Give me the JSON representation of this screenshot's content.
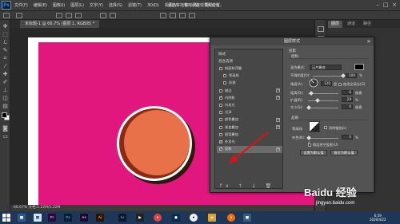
{
  "app": {
    "logo": "Ps"
  },
  "menu": [
    "文件(F)",
    "编辑(E)",
    "图像(I)",
    "图层(L)",
    "文字(Y)",
    "选择(S)",
    "滤镜(T)",
    "3D(D)",
    "视图(V)",
    "窗口(W)",
    "帮助(H)"
  ],
  "title_bar": "点击并拖移可调整效果的位置。",
  "doc_tab": "未标题-1 @ 66.7% (图层 1, RGB/8) *",
  "right_panel": {
    "tabs": [
      "图层",
      "通道",
      "路径"
    ]
  },
  "dialog": {
    "title": "图层样式",
    "left_header": "样式",
    "blend_label": "混合选项",
    "styles": [
      {
        "label": "斜面和浮雕",
        "checked": false,
        "plus": false
      },
      {
        "label": "等高线",
        "checked": false,
        "plus": false,
        "indent": true
      },
      {
        "label": "纹理",
        "checked": false,
        "plus": false,
        "indent": true
      },
      {
        "label": "描边",
        "checked": false,
        "plus": true
      },
      {
        "label": "内阴影",
        "checked": true,
        "plus": true
      },
      {
        "label": "内发光",
        "checked": false,
        "plus": false
      },
      {
        "label": "光泽",
        "checked": false,
        "plus": false
      },
      {
        "label": "颜色叠加",
        "checked": false,
        "plus": true
      },
      {
        "label": "渐变叠加",
        "checked": false,
        "plus": true
      },
      {
        "label": "图案叠加",
        "checked": false,
        "plus": false
      },
      {
        "label": "外发光",
        "checked": true,
        "plus": false
      },
      {
        "label": "投影",
        "checked": true,
        "plus": true,
        "selected": true
      }
    ],
    "bottom_icons": "fx ↑ ↓ 🗑",
    "section_title": "投影",
    "structure": "结构",
    "blend_mode_label": "混合模式:",
    "blend_mode_value": "正片叠底",
    "opacity_label": "不透明度(O):",
    "opacity_value": "100",
    "angle_label": "角度(A):",
    "angle_value": "120",
    "global_light": "使用全局光(G)",
    "distance_label": "距离(D):",
    "distance_value": "6",
    "spread_label": "扩展(R):",
    "spread_value": "29",
    "size_label": "大小(S):",
    "size_value": "0",
    "unit_px": "像素",
    "unit_pct": "%",
    "unit_deg": "度",
    "quality": "品质",
    "contour_label": "等高线:",
    "antialias": "消除锯齿(L)",
    "noise_label": "杂色(N):",
    "noise_value": "0",
    "knockout": "图层挖空投影(U)",
    "btn_default": "设置为默认值",
    "btn_reset": "复位为默认值"
  },
  "status": "66.67%    文档:1.22M/1.22M",
  "taskbar": {
    "time": "6:59",
    "date": "2020/4/22"
  },
  "watermark": {
    "main": "Baidu 经验",
    "sub": "jingyan.baidu.com"
  },
  "colors": {
    "canvas": "#e1177d",
    "circle": "#e8714a",
    "accent": "#2fa3f7"
  }
}
